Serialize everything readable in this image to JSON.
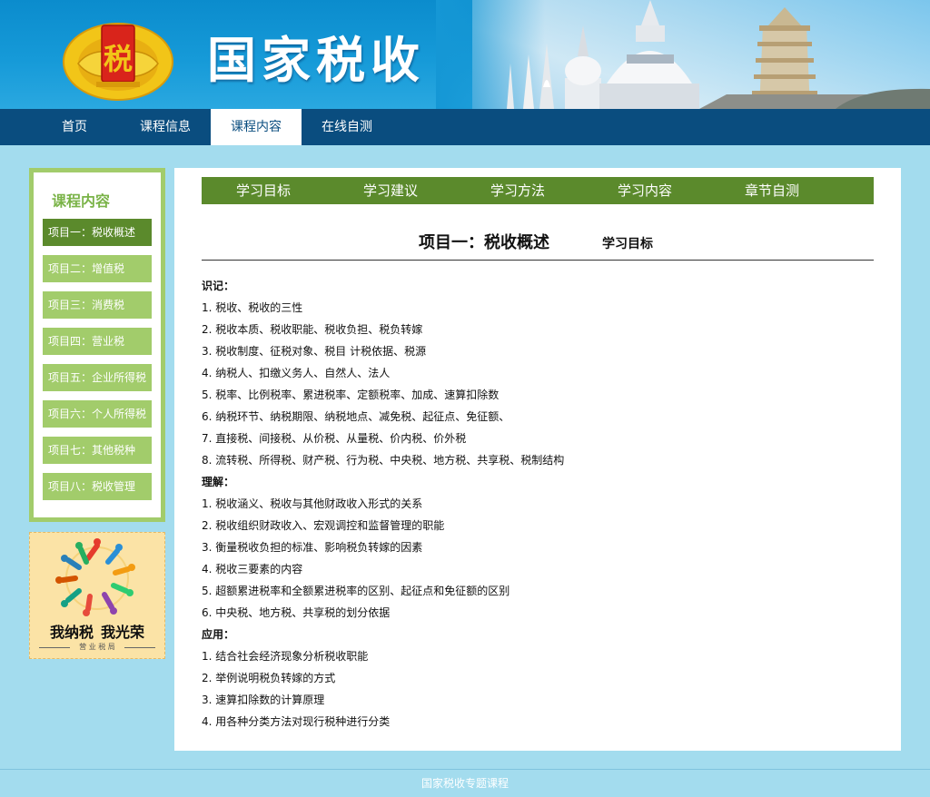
{
  "banner": {
    "title": "国家税收",
    "emblem_text": "税",
    "colors": {
      "blue": "#0b8ccd",
      "emblem_red": "#d9241b",
      "emblem_gold": "#f2c518"
    }
  },
  "nav": {
    "items": [
      {
        "label": "首页",
        "active": false
      },
      {
        "label": "课程信息",
        "active": false
      },
      {
        "label": "课程内容",
        "active": true
      },
      {
        "label": "在线自测",
        "active": false
      }
    ]
  },
  "sidebar": {
    "title": "课程内容",
    "items": [
      {
        "label": "项目一：税收概述",
        "active": true
      },
      {
        "label": "项目二：增值税",
        "active": false
      },
      {
        "label": "项目三：消费税",
        "active": false
      },
      {
        "label": "项目四：营业税",
        "active": false
      },
      {
        "label": "项目五：企业所得税",
        "active": false
      },
      {
        "label": "项目六：个人所得税",
        "active": false
      },
      {
        "label": "项目七：其他税种",
        "active": false
      },
      {
        "label": "项目八：税收管理",
        "active": false
      }
    ]
  },
  "ad": {
    "slogan_left": "我纳税",
    "slogan_right": "我光荣",
    "sub": "营 业 税 局"
  },
  "main": {
    "tabs": [
      {
        "label": "学习目标"
      },
      {
        "label": "学习建议"
      },
      {
        "label": "学习方法"
      },
      {
        "label": "学习内容"
      },
      {
        "label": "章节自测"
      }
    ],
    "heading": "项目一：税收概述",
    "subheading": "学习目标",
    "sections": [
      {
        "title": "识记：",
        "items": [
          "1. 税收、税收的三性",
          "2. 税收本质、税收职能、税收负担、税负转嫁",
          "3. 税收制度、征税对象、税目 计税依据、税源",
          "4. 纳税人、扣缴义务人、自然人、法人",
          "5. 税率、比例税率、累进税率、定额税率、加成、速算扣除数",
          "6. 纳税环节、纳税期限、纳税地点、减免税、起征点、免征额、",
          "7. 直接税、间接税、从价税、从量税、价内税、价外税",
          "8. 流转税、所得税、财产税、行为税、中央税、地方税、共享税、税制结构"
        ]
      },
      {
        "title": "理解：",
        "items": [
          "1. 税收涵义、税收与其他财政收入形式的关系",
          "2. 税收组织财政收入、宏观调控和监督管理的职能",
          "3. 衡量税收负担的标准、影响税负转嫁的因素",
          "4. 税收三要素的内容",
          "5. 超额累进税率和全额累进税率的区别、起征点和免征额的区别",
          "6. 中央税、地方税、共享税的划分依据"
        ]
      },
      {
        "title": "应用：",
        "items": [
          "1. 结合社会经济现象分析税收职能",
          "2. 举例说明税负转嫁的方式",
          "3. 速算扣除数的计算原理",
          "4. 用各种分类方法对现行税种进行分类"
        ]
      }
    ]
  },
  "footer": {
    "text": "国家税收专题课程"
  }
}
